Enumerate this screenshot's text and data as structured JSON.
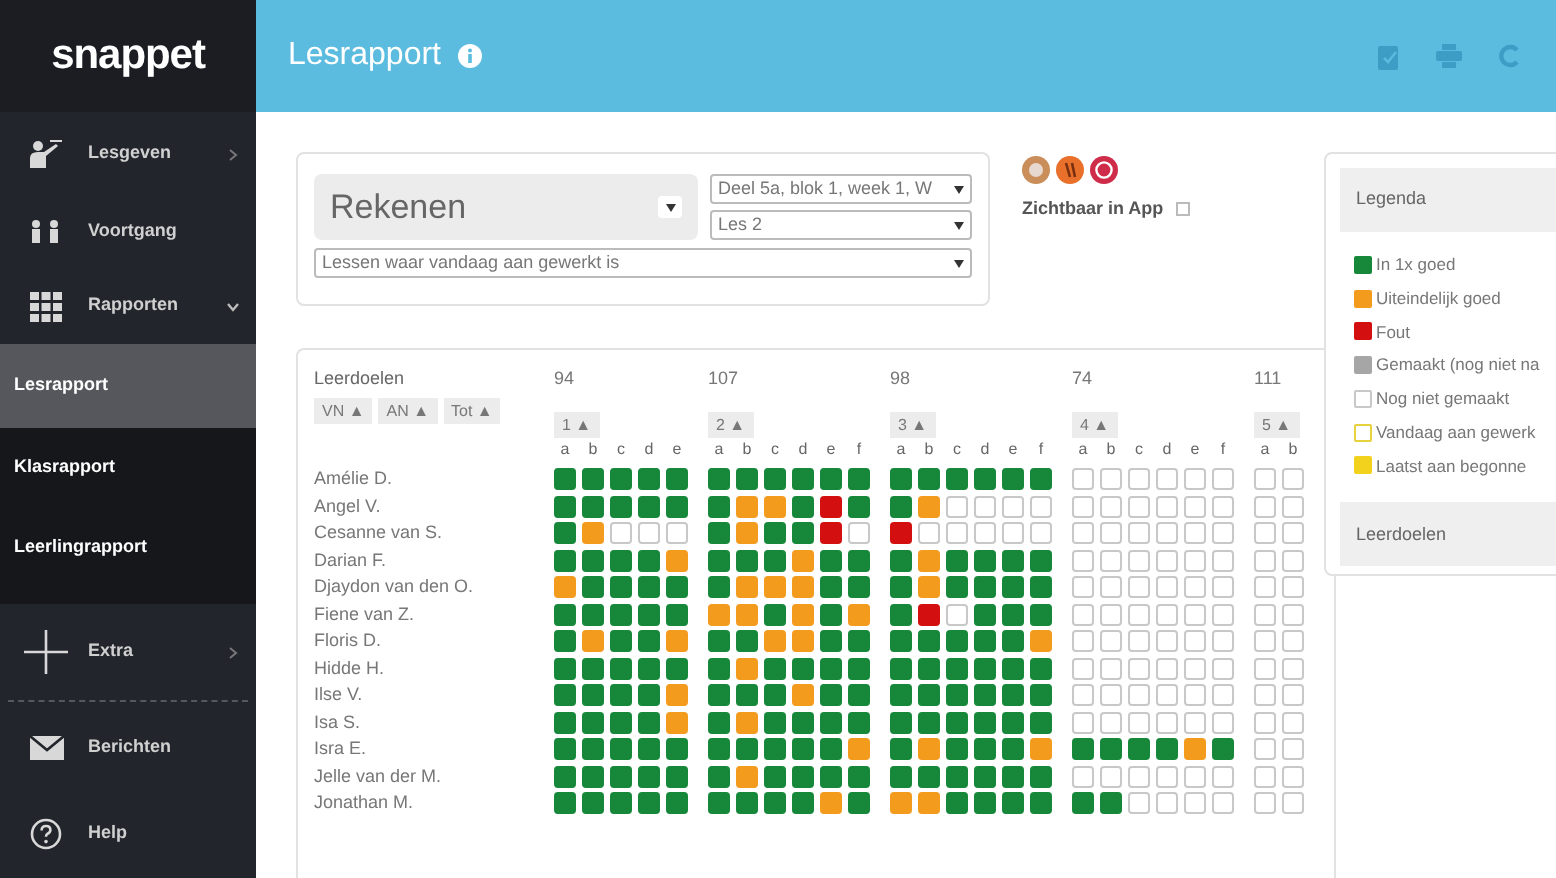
{
  "sidebar": {
    "logo": "snappet",
    "items": [
      {
        "label": "Lesgeven",
        "kind": "menu",
        "expanded": false
      },
      {
        "label": "Voortgang",
        "kind": "link"
      },
      {
        "label": "Rapporten",
        "kind": "menu",
        "expanded": true,
        "children": [
          {
            "label": "Lesrapport",
            "selected": true
          },
          {
            "label": "Klasrapport",
            "selected": false
          },
          {
            "label": "Leerlingrapport",
            "selected": false
          }
        ]
      },
      {
        "label": "Extra",
        "kind": "menu",
        "expanded": false
      },
      {
        "label": "Berichten",
        "kind": "link"
      },
      {
        "label": "Help",
        "kind": "link"
      }
    ]
  },
  "header": {
    "title": "Lesrapport"
  },
  "filters": {
    "subject": "Rekenen",
    "week": "Deel 5a, blok 1, week 1, W",
    "lesson": "Les 2",
    "lessons_filter": "Lessen waar vandaag aan gewerkt is",
    "visible_label": "Zichtbaar in App",
    "visible_checked": false
  },
  "report": {
    "heading": "Leerdoelen",
    "sort_buttons": [
      "VN ▲",
      "AN ▲",
      "Tot ▲"
    ],
    "groups": [
      {
        "number": "94",
        "sort": "1 ▲",
        "letters": [
          "a",
          "b",
          "c",
          "d",
          "e"
        ]
      },
      {
        "number": "107",
        "sort": "2 ▲",
        "letters": [
          "a",
          "b",
          "c",
          "d",
          "e",
          "f"
        ]
      },
      {
        "number": "98",
        "sort": "3 ▲",
        "letters": [
          "a",
          "b",
          "c",
          "d",
          "e",
          "f"
        ]
      },
      {
        "number": "74",
        "sort": "4 ▲",
        "letters": [
          "a",
          "b",
          "c",
          "d",
          "e",
          "f"
        ]
      },
      {
        "number": "111",
        "sort": "5 ▲",
        "letters": [
          "a",
          "b"
        ]
      }
    ],
    "rows": [
      {
        "name": "Amélie D.",
        "cells": [
          [
            {
              "kind": "correct"
            },
            {
              "kind": "correct"
            },
            {
              "kind": "correct"
            },
            {
              "kind": "correct"
            },
            {
              "kind": "correct"
            }
          ],
          [
            {
              "kind": "correct"
            },
            {
              "kind": "correct"
            },
            {
              "kind": "correct"
            },
            {
              "kind": "correct"
            },
            {
              "kind": "correct"
            },
            {
              "kind": "correct"
            }
          ],
          [
            {
              "kind": "correct"
            },
            {
              "kind": "correct"
            },
            {
              "kind": "correct"
            },
            {
              "kind": "correct"
            },
            {
              "kind": "correct"
            },
            {
              "kind": "correct"
            }
          ],
          [
            {
              "kind": "open"
            },
            {
              "kind": "open"
            },
            {
              "kind": "open"
            },
            {
              "kind": "open"
            },
            {
              "kind": "open"
            },
            {
              "kind": "open"
            }
          ],
          [
            {
              "kind": "open"
            },
            {
              "kind": "open"
            }
          ]
        ]
      },
      {
        "name": "Angel V.",
        "cells": [
          [
            {
              "kind": "correct"
            },
            {
              "kind": "correct"
            },
            {
              "kind": "correct"
            },
            {
              "kind": "correct"
            },
            {
              "kind": "correct"
            }
          ],
          [
            {
              "kind": "correct"
            },
            {
              "kind": "eventual"
            },
            {
              "kind": "eventual"
            },
            {
              "kind": "correct"
            },
            {
              "kind": "wrong"
            },
            {
              "kind": "correct"
            }
          ],
          [
            {
              "kind": "correct"
            },
            {
              "kind": "eventual"
            },
            {
              "kind": "open"
            },
            {
              "kind": "open"
            },
            {
              "kind": "open"
            },
            {
              "kind": "open"
            }
          ],
          [
            {
              "kind": "open"
            },
            {
              "kind": "open"
            },
            {
              "kind": "open"
            },
            {
              "kind": "open"
            },
            {
              "kind": "open"
            },
            {
              "kind": "open"
            }
          ],
          [
            {
              "kind": "open"
            },
            {
              "kind": "open"
            }
          ]
        ]
      },
      {
        "name": "Cesanne van S.",
        "cells": [
          [
            {
              "kind": "correct"
            },
            {
              "kind": "eventual"
            },
            {
              "kind": "open"
            },
            {
              "kind": "open"
            },
            {
              "kind": "open"
            }
          ],
          [
            {
              "kind": "correct"
            },
            {
              "kind": "eventual"
            },
            {
              "kind": "correct"
            },
            {
              "kind": "correct"
            },
            {
              "kind": "wrong"
            },
            {
              "kind": "open"
            }
          ],
          [
            {
              "kind": "wrong"
            },
            {
              "kind": "open"
            },
            {
              "kind": "open"
            },
            {
              "kind": "open"
            },
            {
              "kind": "open"
            },
            {
              "kind": "open"
            }
          ],
          [
            {
              "kind": "open"
            },
            {
              "kind": "open"
            },
            {
              "kind": "open"
            },
            {
              "kind": "open"
            },
            {
              "kind": "open"
            },
            {
              "kind": "open"
            }
          ],
          [
            {
              "kind": "open"
            },
            {
              "kind": "open"
            }
          ]
        ]
      },
      {
        "name": "Darian F.",
        "cells": [
          [
            {
              "kind": "correct"
            },
            {
              "kind": "correct"
            },
            {
              "kind": "correct"
            },
            {
              "kind": "correct"
            },
            {
              "kind": "eventual"
            }
          ],
          [
            {
              "kind": "correct"
            },
            {
              "kind": "correct"
            },
            {
              "kind": "correct"
            },
            {
              "kind": "eventual"
            },
            {
              "kind": "correct"
            },
            {
              "kind": "correct"
            }
          ],
          [
            {
              "kind": "correct"
            },
            {
              "kind": "eventual"
            },
            {
              "kind": "correct"
            },
            {
              "kind": "correct"
            },
            {
              "kind": "correct"
            },
            {
              "kind": "correct"
            }
          ],
          [
            {
              "kind": "open"
            },
            {
              "kind": "open"
            },
            {
              "kind": "open"
            },
            {
              "kind": "open"
            },
            {
              "kind": "open"
            },
            {
              "kind": "open"
            }
          ],
          [
            {
              "kind": "open"
            },
            {
              "kind": "open"
            }
          ]
        ]
      },
      {
        "name": "Djaydon van den O.",
        "cells": [
          [
            {
              "kind": "eventual"
            },
            {
              "kind": "correct"
            },
            {
              "kind": "correct"
            },
            {
              "kind": "correct"
            },
            {
              "kind": "correct"
            }
          ],
          [
            {
              "kind": "correct"
            },
            {
              "kind": "eventual"
            },
            {
              "kind": "eventual"
            },
            {
              "kind": "eventual"
            },
            {
              "kind": "correct"
            },
            {
              "kind": "correct"
            }
          ],
          [
            {
              "kind": "correct"
            },
            {
              "kind": "eventual"
            },
            {
              "kind": "correct"
            },
            {
              "kind": "correct"
            },
            {
              "kind": "correct"
            },
            {
              "kind": "correct"
            }
          ],
          [
            {
              "kind": "open"
            },
            {
              "kind": "open"
            },
            {
              "kind": "open"
            },
            {
              "kind": "open"
            },
            {
              "kind": "open"
            },
            {
              "kind": "open"
            }
          ],
          [
            {
              "kind": "open"
            },
            {
              "kind": "open"
            }
          ]
        ]
      },
      {
        "name": "Fiene van Z.",
        "cells": [
          [
            {
              "kind": "correct"
            },
            {
              "kind": "correct"
            },
            {
              "kind": "correct"
            },
            {
              "kind": "correct"
            },
            {
              "kind": "correct"
            }
          ],
          [
            {
              "kind": "eventual"
            },
            {
              "kind": "eventual"
            },
            {
              "kind": "correct"
            },
            {
              "kind": "eventual"
            },
            {
              "kind": "correct"
            },
            {
              "kind": "eventual"
            }
          ],
          [
            {
              "kind": "correct"
            },
            {
              "kind": "wrong"
            },
            {
              "kind": "open"
            },
            {
              "kind": "correct"
            },
            {
              "kind": "correct"
            },
            {
              "kind": "correct"
            }
          ],
          [
            {
              "kind": "open"
            },
            {
              "kind": "open"
            },
            {
              "kind": "open"
            },
            {
              "kind": "open"
            },
            {
              "kind": "open"
            },
            {
              "kind": "open"
            }
          ],
          [
            {
              "kind": "open"
            },
            {
              "kind": "open"
            }
          ]
        ]
      },
      {
        "name": "Floris D.",
        "cells": [
          [
            {
              "kind": "correct"
            },
            {
              "kind": "eventual"
            },
            {
              "kind": "correct"
            },
            {
              "kind": "correct"
            },
            {
              "kind": "eventual"
            }
          ],
          [
            {
              "kind": "correct"
            },
            {
              "kind": "correct"
            },
            {
              "kind": "eventual"
            },
            {
              "kind": "eventual"
            },
            {
              "kind": "correct"
            },
            {
              "kind": "correct"
            }
          ],
          [
            {
              "kind": "correct"
            },
            {
              "kind": "correct"
            },
            {
              "kind": "correct"
            },
            {
              "kind": "correct"
            },
            {
              "kind": "correct"
            },
            {
              "kind": "eventual"
            }
          ],
          [
            {
              "kind": "open"
            },
            {
              "kind": "open"
            },
            {
              "kind": "open"
            },
            {
              "kind": "open"
            },
            {
              "kind": "open"
            },
            {
              "kind": "open"
            }
          ],
          [
            {
              "kind": "open"
            },
            {
              "kind": "open"
            }
          ]
        ]
      },
      {
        "name": "Hidde H.",
        "cells": [
          [
            {
              "kind": "correct"
            },
            {
              "kind": "correct"
            },
            {
              "kind": "correct"
            },
            {
              "kind": "correct"
            },
            {
              "kind": "correct"
            }
          ],
          [
            {
              "kind": "correct"
            },
            {
              "kind": "eventual"
            },
            {
              "kind": "correct"
            },
            {
              "kind": "correct"
            },
            {
              "kind": "correct"
            },
            {
              "kind": "correct"
            }
          ],
          [
            {
              "kind": "correct"
            },
            {
              "kind": "correct"
            },
            {
              "kind": "correct"
            },
            {
              "kind": "correct"
            },
            {
              "kind": "correct"
            },
            {
              "kind": "correct"
            }
          ],
          [
            {
              "kind": "open"
            },
            {
              "kind": "open"
            },
            {
              "kind": "open"
            },
            {
              "kind": "open"
            },
            {
              "kind": "open"
            },
            {
              "kind": "open"
            }
          ],
          [
            {
              "kind": "open"
            },
            {
              "kind": "open"
            }
          ]
        ]
      },
      {
        "name": "Ilse V.",
        "cells": [
          [
            {
              "kind": "correct"
            },
            {
              "kind": "correct"
            },
            {
              "kind": "correct"
            },
            {
              "kind": "correct"
            },
            {
              "kind": "eventual"
            }
          ],
          [
            {
              "kind": "correct"
            },
            {
              "kind": "correct"
            },
            {
              "kind": "correct"
            },
            {
              "kind": "eventual"
            },
            {
              "kind": "correct"
            },
            {
              "kind": "correct"
            }
          ],
          [
            {
              "kind": "correct"
            },
            {
              "kind": "correct"
            },
            {
              "kind": "correct"
            },
            {
              "kind": "correct"
            },
            {
              "kind": "correct"
            },
            {
              "kind": "correct"
            }
          ],
          [
            {
              "kind": "open"
            },
            {
              "kind": "open"
            },
            {
              "kind": "open"
            },
            {
              "kind": "open"
            },
            {
              "kind": "open"
            },
            {
              "kind": "open"
            }
          ],
          [
            {
              "kind": "open"
            },
            {
              "kind": "open"
            }
          ]
        ]
      },
      {
        "name": "Isa S.",
        "cells": [
          [
            {
              "kind": "correct"
            },
            {
              "kind": "correct"
            },
            {
              "kind": "correct"
            },
            {
              "kind": "correct"
            },
            {
              "kind": "eventual"
            }
          ],
          [
            {
              "kind": "correct"
            },
            {
              "kind": "eventual"
            },
            {
              "kind": "correct"
            },
            {
              "kind": "correct"
            },
            {
              "kind": "correct"
            },
            {
              "kind": "correct"
            }
          ],
          [
            {
              "kind": "correct"
            },
            {
              "kind": "correct"
            },
            {
              "kind": "correct"
            },
            {
              "kind": "correct"
            },
            {
              "kind": "correct"
            },
            {
              "kind": "correct"
            }
          ],
          [
            {
              "kind": "open"
            },
            {
              "kind": "open"
            },
            {
              "kind": "open"
            },
            {
              "kind": "open"
            },
            {
              "kind": "open"
            },
            {
              "kind": "open"
            }
          ],
          [
            {
              "kind": "open"
            },
            {
              "kind": "open"
            }
          ]
        ]
      },
      {
        "name": "Isra E.",
        "cells": [
          [
            {
              "kind": "correct"
            },
            {
              "kind": "correct"
            },
            {
              "kind": "correct"
            },
            {
              "kind": "correct"
            },
            {
              "kind": "correct"
            }
          ],
          [
            {
              "kind": "correct"
            },
            {
              "kind": "correct"
            },
            {
              "kind": "correct"
            },
            {
              "kind": "correct"
            },
            {
              "kind": "correct"
            },
            {
              "kind": "eventual"
            }
          ],
          [
            {
              "kind": "correct"
            },
            {
              "kind": "eventual"
            },
            {
              "kind": "correct"
            },
            {
              "kind": "correct"
            },
            {
              "kind": "correct"
            },
            {
              "kind": "eventual"
            }
          ],
          [
            {
              "kind": "correct"
            },
            {
              "kind": "correct"
            },
            {
              "kind": "correct"
            },
            {
              "kind": "correct"
            },
            {
              "kind": "eventual"
            },
            {
              "kind": "correct"
            }
          ],
          [
            {
              "kind": "open"
            },
            {
              "kind": "open"
            }
          ]
        ]
      },
      {
        "name": "Jelle van der M.",
        "cells": [
          [
            {
              "kind": "correct"
            },
            {
              "kind": "correct"
            },
            {
              "kind": "correct"
            },
            {
              "kind": "correct"
            },
            {
              "kind": "correct"
            }
          ],
          [
            {
              "kind": "correct"
            },
            {
              "kind": "eventual"
            },
            {
              "kind": "correct"
            },
            {
              "kind": "correct"
            },
            {
              "kind": "correct"
            },
            {
              "kind": "correct"
            }
          ],
          [
            {
              "kind": "correct"
            },
            {
              "kind": "correct"
            },
            {
              "kind": "correct"
            },
            {
              "kind": "correct"
            },
            {
              "kind": "correct"
            },
            {
              "kind": "correct"
            }
          ],
          [
            {
              "kind": "open"
            },
            {
              "kind": "open"
            },
            {
              "kind": "open"
            },
            {
              "kind": "open"
            },
            {
              "kind": "open"
            },
            {
              "kind": "open"
            }
          ],
          [
            {
              "kind": "open"
            },
            {
              "kind": "open"
            }
          ]
        ]
      },
      {
        "name": "Jonathan M.",
        "cells": [
          [
            {
              "kind": "correct"
            },
            {
              "kind": "correct"
            },
            {
              "kind": "correct"
            },
            {
              "kind": "correct"
            },
            {
              "kind": "correct"
            }
          ],
          [
            {
              "kind": "correct"
            },
            {
              "kind": "correct"
            },
            {
              "kind": "correct"
            },
            {
              "kind": "correct"
            },
            {
              "kind": "eventual"
            },
            {
              "kind": "correct"
            }
          ],
          [
            {
              "kind": "eventual"
            },
            {
              "kind": "eventual"
            },
            {
              "kind": "correct"
            },
            {
              "kind": "correct"
            },
            {
              "kind": "correct"
            },
            {
              "kind": "correct"
            }
          ],
          [
            {
              "kind": "correct"
            },
            {
              "kind": "correct"
            },
            {
              "kind": "open"
            },
            {
              "kind": "open"
            },
            {
              "kind": "open"
            },
            {
              "kind": "open"
            }
          ],
          [
            {
              "kind": "open"
            },
            {
              "kind": "open"
            }
          ]
        ]
      }
    ]
  },
  "legend": {
    "title": "Legenda",
    "items": [
      {
        "label": "In 1x goed",
        "kind": "fill",
        "color": "#17873a"
      },
      {
        "label": "Uiteindelijk goed",
        "kind": "fill",
        "color": "#f29b1d"
      },
      {
        "label": "Fout",
        "kind": "fill",
        "color": "#d40f0f"
      },
      {
        "label": "Gemaakt (nog niet na",
        "kind": "fill",
        "color": "#a6a6a6"
      },
      {
        "label": "Nog niet gemaakt",
        "kind": "outline",
        "color": "#c8c8c8"
      },
      {
        "label": "Vandaag aan gewerk",
        "kind": "outline",
        "color": "#e6d23c"
      },
      {
        "label": "Laatst aan begonne",
        "kind": "fill",
        "color": "#f2d21c"
      }
    ],
    "section": "Leerdoelen"
  }
}
